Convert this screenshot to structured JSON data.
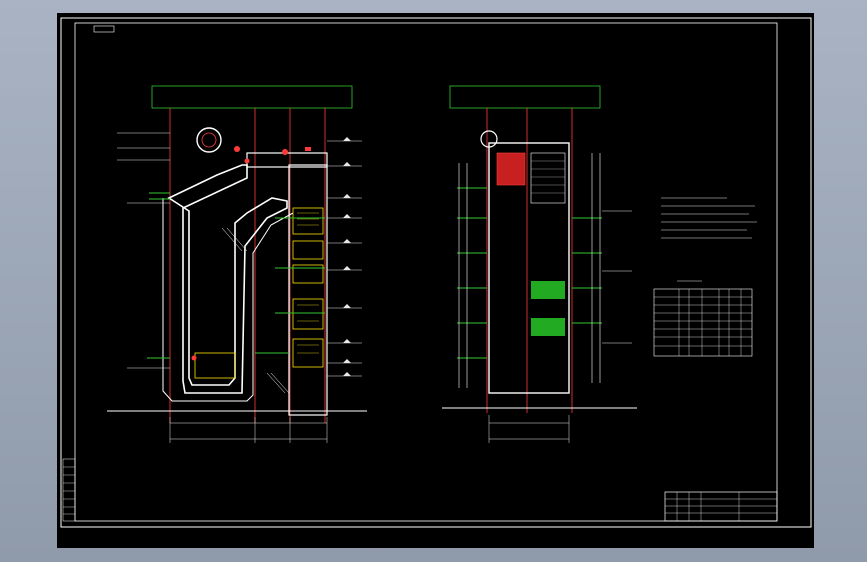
{
  "sheet": {
    "frame_tag": "",
    "corner_note": "",
    "title_block": {
      "drawing_title": "",
      "scale": "",
      "sheet_no": ""
    }
  },
  "colors": {
    "background": "#000000",
    "surround": "#9aa4b4",
    "linework": "#ffffff",
    "walls": "#ff3a3a",
    "equipment": "#ffe400",
    "structure": "#32c832",
    "dimension": "#e8e8e8"
  },
  "icons": {
    "drum": "circle-drum",
    "stair": "ladder-hatch",
    "level": "triangle-level-marker"
  }
}
